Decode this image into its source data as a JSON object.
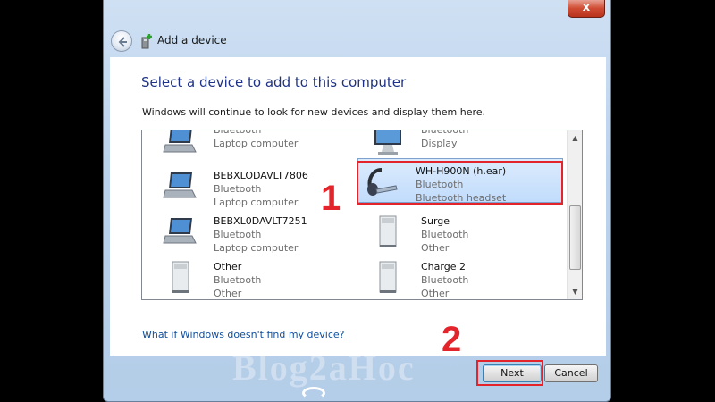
{
  "window": {
    "title": "Add a device",
    "close_label": "x"
  },
  "content": {
    "heading": "Select a device to add to this computer",
    "subtext": "Windows will continue to look for new devices and display them here.",
    "devices": [
      {
        "name": "",
        "type": "Bluetooth",
        "category": "Laptop computer",
        "icon": "laptop-icon"
      },
      {
        "name": "",
        "type": "Bluetooth",
        "category": "Display",
        "icon": "monitor-icon"
      },
      {
        "name": "BEBXLODAVLT7806",
        "type": "Bluetooth",
        "category": "Laptop computer",
        "icon": "laptop-icon"
      },
      {
        "name": "WH-H900N (h.ear)",
        "type": "Bluetooth",
        "category": "Bluetooth headset",
        "icon": "headset-icon",
        "selected": true
      },
      {
        "name": "BEBXL0DAVLT7251",
        "type": "Bluetooth",
        "category": "Laptop computer",
        "icon": "laptop-icon"
      },
      {
        "name": "Surge",
        "type": "Bluetooth",
        "category": "Other",
        "icon": "device-tower-icon"
      },
      {
        "name": "Other",
        "type": "Bluetooth",
        "category": "Other",
        "icon": "device-tower-icon"
      },
      {
        "name": "Charge 2",
        "type": "Bluetooth",
        "category": "Other",
        "icon": "device-tower-icon"
      }
    ],
    "help_link": "What if Windows doesn't find my device?"
  },
  "footer": {
    "next_label": "Next",
    "cancel_label": "Cancel"
  },
  "annotations": {
    "step1": "1",
    "step2": "2"
  },
  "watermark": "Blog2aHoc",
  "colors": {
    "heading": "#1e3287",
    "annotation": "#e3242b",
    "selection": "#c1dcfc"
  }
}
